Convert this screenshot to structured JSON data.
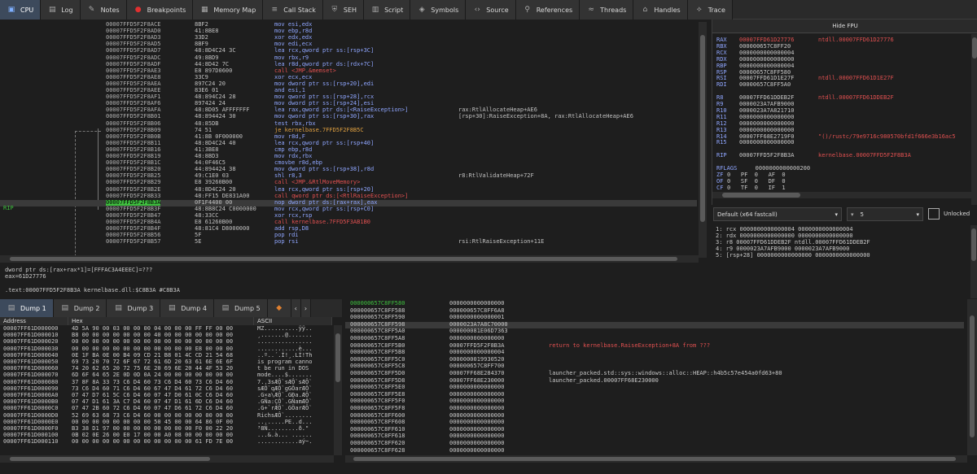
{
  "tabs": [
    {
      "label": "CPU",
      "icon": "cpu-icon",
      "active": true
    },
    {
      "label": "Log",
      "icon": "log-icon"
    },
    {
      "label": "Notes",
      "icon": "notes-icon"
    },
    {
      "label": "Breakpoints",
      "icon": "breakpoint-icon"
    },
    {
      "label": "Memory Map",
      "icon": "memory-map-icon"
    },
    {
      "label": "Call Stack",
      "icon": "call-stack-icon"
    },
    {
      "label": "SEH",
      "icon": "seh-icon"
    },
    {
      "label": "Script",
      "icon": "script-icon"
    },
    {
      "label": "Symbols",
      "icon": "symbols-icon"
    },
    {
      "label": "Source",
      "icon": "source-icon"
    },
    {
      "label": "References",
      "icon": "references-icon"
    },
    {
      "label": "Threads",
      "icon": "threads-icon"
    },
    {
      "label": "Handles",
      "icon": "handles-icon"
    },
    {
      "label": "Trace",
      "icon": "trace-icon"
    }
  ],
  "disasm": [
    {
      "addr": "00007FFD5F2F8ACE",
      "bytes": "8BF2",
      "ins": "mov esi,edx"
    },
    {
      "addr": "00007FFD5F2F8AD0",
      "bytes": "41:8BE8",
      "ins": "mov ebp,r8d"
    },
    {
      "addr": "00007FFD5F2F8AD3",
      "bytes": "33D2",
      "ins": "xor edx,edx"
    },
    {
      "addr": "00007FFD5F2F8AD5",
      "bytes": "8BF9",
      "ins": "mov edi,ecx"
    },
    {
      "addr": "00007FFD5F2F8AD7",
      "bytes": "48:8D4C24 3C",
      "ins": "lea rcx,qword ptr ss:[rsp+3C]"
    },
    {
      "addr": "00007FFD5F2F8ADC",
      "bytes": "49:8BD9",
      "ins": "mov rbx,r9"
    },
    {
      "addr": "00007FFD5F2F8ADF",
      "bytes": "44:8D42 7C",
      "ins": "lea r8d,qword ptr ds:[rdx+7C]"
    },
    {
      "addr": "00007FFD5F2F8AE3",
      "bytes": "E8 897D0600",
      "ins": "call <JMP.&memset>",
      "t": "call"
    },
    {
      "addr": "00007FFD5F2F8AE8",
      "bytes": "33C9",
      "ins": "xor ecx,ecx"
    },
    {
      "addr": "00007FFD5F2F8AEA",
      "bytes": "897C24 20",
      "ins": "mov dword ptr ss:[rsp+20],edi"
    },
    {
      "addr": "00007FFD5F2F8AEE",
      "bytes": "83E6 01",
      "ins": "and esi,1"
    },
    {
      "addr": "00007FFD5F2F8AF1",
      "bytes": "48:894C24 28",
      "ins": "mov qword ptr ss:[rsp+28],rcx"
    },
    {
      "addr": "00007FFD5F2F8AF6",
      "bytes": "897424 24",
      "ins": "mov dword ptr ss:[rsp+24],esi"
    },
    {
      "addr": "00007FFD5F2F8AFA",
      "bytes": "48:8D05 AFFFFFFF",
      "ins": "lea rax,qword ptr ds:[<RaiseException>]",
      "cmt": "rax:RtlAllocateHeap+AE6"
    },
    {
      "addr": "00007FFD5F2F8B01",
      "bytes": "48:894424 30",
      "ins": "mov qword ptr ss:[rsp+30],rax",
      "cmt": "[rsp+30]:RaiseException+8A, rax:RtlAllocateHeap+AE6"
    },
    {
      "addr": "00007FFD5F2F8B06",
      "bytes": "48:85DB",
      "ins": "test rbx,rbx"
    },
    {
      "addr": "00007FFD5F2F8B09",
      "bytes": "74 51",
      "ins": "je kernelbase.7FFD5F2F8B5C",
      "t": "jmp"
    },
    {
      "addr": "00007FFD5F2F8B0B",
      "bytes": "41:8B 0F000000",
      "ins": "mov r8d,F"
    },
    {
      "addr": "00007FFD5F2F8B11",
      "bytes": "48:8D4C24 40",
      "ins": "lea rcx,qword ptr ss:[rsp+40]"
    },
    {
      "addr": "00007FFD5F2F8B16",
      "bytes": "41:3BE8",
      "ins": "cmp ebp,r8d"
    },
    {
      "addr": "00007FFD5F2F8B19",
      "bytes": "48:8BD3",
      "ins": "mov rdx,rbx"
    },
    {
      "addr": "00007FFD5F2F8B1C",
      "bytes": "44:0F46C5",
      "ins": "cmovbe r8d,ebp"
    },
    {
      "addr": "00007FFD5F2F8B20",
      "bytes": "44:894424 38",
      "ins": "mov dword ptr ss:[rsp+38],r8d"
    },
    {
      "addr": "00007FFD5F2F8B25",
      "bytes": "49:C1E0 03",
      "ins": "shl r8,3",
      "cmt": "r8:RtlValidateHeap+72F"
    },
    {
      "addr": "00007FFD5F2F8B29",
      "bytes": "E8 39260B00",
      "ins": "call <JMP.&RtlMoveMemory>",
      "t": "call"
    },
    {
      "addr": "00007FFD5F2F8B2E",
      "bytes": "48:8D4C24 20",
      "ins": "lea rcx,qword ptr ss:[rsp+20]"
    },
    {
      "addr": "00007FFD5F2F8B33",
      "bytes": "48:FF15 DE831A00",
      "ins": "call qword ptr ds:[<RtlRaiseException>]",
      "t": "call"
    },
    {
      "addr": "00007FFD5F2F8B3A",
      "bytes": "0F1F4400 00",
      "ins": "nop dword ptr ds:[rax+rax],eax",
      "rip": true
    },
    {
      "addr": "00007FFD5F2F8B3F",
      "bytes": "48:8B8C24 C0000000",
      "ins": "mov rcx,qword ptr ss:[rsp+C0]"
    },
    {
      "addr": "00007FFD5F2F8B47",
      "bytes": "48:33CC",
      "ins": "xor rcx,rsp"
    },
    {
      "addr": "00007FFD5F2F8B4A",
      "bytes": "E8 61260B00",
      "ins": "call kernelbase.7FFD5F3AB1B0",
      "t": "call"
    },
    {
      "addr": "00007FFD5F2F8B4F",
      "bytes": "48:81C4 D8000000",
      "ins": "add rsp,D8"
    },
    {
      "addr": "00007FFD5F2F8B56",
      "bytes": "5F",
      "ins": "pop rdi"
    },
    {
      "addr": "00007FFD5F2F8B57",
      "bytes": "5E",
      "ins": "pop rsi",
      "cmt": "rsi:RtlRaiseException+11E"
    }
  ],
  "rip_label": "RIP",
  "info": {
    "line1": "dword ptr ds:[rax+rax*1]=[FFFAC3A4EEEC]=???",
    "line2": "eax=61D27776",
    "line3": ".text:00007FFD5F2F8B3A kernelbase.dll:$C8B3A #C8B3A"
  },
  "fpu_button": "Hide FPU",
  "registers": [
    {
      "n": "RAX",
      "v": "00007FFD61D27776",
      "c": "ntdll.00007FFD61D27776",
      "ch": true
    },
    {
      "n": "RBX",
      "v": "000000657C8FF20"
    },
    {
      "n": "RCX",
      "v": "0000000000000004"
    },
    {
      "n": "RDX",
      "v": "0000000000000000"
    },
    {
      "n": "RBP",
      "v": "0000000000000004"
    },
    {
      "n": "RSP",
      "v": "00000657C8FF580"
    },
    {
      "n": "RSI",
      "v": "00007FFD61D1E27F",
      "c": "ntdll.00007FFD61D1E27F"
    },
    {
      "n": "RDI",
      "v": "00000657C8FF5A0"
    },
    {
      "n": "",
      "v": ""
    },
    {
      "n": "R8",
      "v": "00007FFD61DDEB2F",
      "c": "ntdll.00007FFD61DDEB2F"
    },
    {
      "n": "R9",
      "v": "0000023A7AFB9000"
    },
    {
      "n": "R10",
      "v": "0000023A7A821710"
    },
    {
      "n": "R11",
      "v": "0000000000000000"
    },
    {
      "n": "R12",
      "v": "0000000000000000"
    },
    {
      "n": "R13",
      "v": "0000000000000000"
    },
    {
      "n": "R14",
      "v": "00007FF68E2719F0",
      "c": "\"()/rustc/79e9716c980570bfd1f666e3b16ac5"
    },
    {
      "n": "R15",
      "v": "0000000000000000"
    },
    {
      "n": "",
      "v": ""
    },
    {
      "n": "RIP",
      "v": "00007FFD5F2F8B3A",
      "c": "kernelbase.00007FFD5F2F8B3A"
    },
    {
      "n": "",
      "v": ""
    },
    {
      "n": "RFLAGS",
      "v": "   0000000000000200"
    },
    {
      "n": "ZF",
      "v": "0   PF  0   AF  0"
    },
    {
      "n": "OF",
      "v": "0   SF  0   DF  0"
    },
    {
      "n": "CF",
      "v": "0   TF  0   IF  1"
    }
  ],
  "callconv": {
    "value": "Default (x64 fastcall)",
    "count": "5",
    "unlocked_label": "Unlocked"
  },
  "args": [
    "1: rcx 0000000000000004 0000000000000004",
    "2: rdx 0000000000000000 0000000000000000",
    "3: r8 00007FFD61DDEB2F ntdll.00007FFD61DDEB2F",
    "4: r9 0000023A7AFB9000 0000023A7AFB9000",
    "5: [rsp+28] 0000000000000000 0000000000000000"
  ],
  "dump_tabs": [
    "Dump 1",
    "Dump 2",
    "Dump 3",
    "Dump 4",
    "Dump 5"
  ],
  "dump_headers": {
    "address": "Address",
    "hex": "Hex",
    "ascii": "ASCII"
  },
  "dump_rows": [
    {
      "a": "00007FF61D000000",
      "h": "4D 5A 90 00 03 00 00 00 04 00 00 00 FF FF 00 00",
      "t": "MZ..........ÿÿ.."
    },
    {
      "a": "00007FF61D000010",
      "h": "B8 00 00 00 00 00 00 00 40 00 00 00 00 00 00 00",
      "t": "¸.......@......."
    },
    {
      "a": "00007FF61D000020",
      "h": "00 00 00 00 00 00 00 00 00 00 00 00 00 00 00 00",
      "t": "................"
    },
    {
      "a": "00007FF61D000030",
      "h": "00 00 00 00 00 00 00 00 00 00 00 00 E8 00 00 00",
      "t": "............è..."
    },
    {
      "a": "00007FF61D000040",
      "h": "0E 1F BA 0E 00 B4 09 CD 21 B8 01 4C CD 21 54 68",
      "t": "..º..´.Í!¸.LÍ!Th"
    },
    {
      "a": "00007FF61D000050",
      "h": "69 73 20 70 72 6F 67 72 61 6D 20 63 61 6E 6E 6F",
      "t": "is program canno"
    },
    {
      "a": "00007FF61D000060",
      "h": "74 20 62 65 20 72 75 6E 20 69 6E 20 44 4F 53 20",
      "t": "t be run in DOS "
    },
    {
      "a": "00007FF61D000070",
      "h": "6D 6F 64 65 2E 0D 0D 0A 24 00 00 00 00 00 00 00",
      "t": "mode....$......."
    },
    {
      "a": "00007FF61D000080",
      "h": "37 8F 8A 33 73 C6 D4 60 73 C6 D4 60 73 C6 D4 60",
      "t": "7..3sÆÔ`sÆÔ`sÆÔ`"
    },
    {
      "a": "00007FF61D000090",
      "h": "73 C6 D4 60 71 C6 D4 60 67 47 D4 61 72 C6 D4 60",
      "t": "sÆÔ`qÆÔ`gGÔarÆÔ`"
    },
    {
      "a": "00007FF61D0000A0",
      "h": "07 47 D7 61 5C C6 D4 60 07 47 D0 61 0C C6 D4 60",
      "t": ".G×a\\ÆÔ`.GÐa.ÆÔ`"
    },
    {
      "a": "00007FF61D0000B0",
      "h": "07 47 D1 61 3A C7 D4 60 07 47 D1 61 6D C6 D4 60",
      "t": ".GÑa:ÇÔ`.GÑamÆÔ`"
    },
    {
      "a": "00007FF61D0000C0",
      "h": "07 47 2B 60 72 C6 D4 60 07 47 D6 61 72 C6 D4 60",
      "t": ".G+`rÆÔ`.GÖarÆÔ`"
    },
    {
      "a": "00007FF61D0000D0",
      "h": "52 69 63 68 73 C6 D4 60 00 00 00 00 00 00 00 00",
      "t": "RichsÆÔ`........"
    },
    {
      "a": "00007FF61D0000E0",
      "h": "00 00 00 00 00 00 00 00 50 45 00 00 64 86 0F 00",
      "t": "........PE..d..."
    },
    {
      "a": "00007FF61D0000F0",
      "h": "B3 38 D1 97 00 00 00 00 00 00 00 00 F0 00 22 20",
      "t": "³8Ñ.........ð.\" "
    },
    {
      "a": "00007FF61D000100",
      "h": "0B 02 0E 26 00 E0 17 00 00 A0 08 00 00 00 00 00",
      "t": "...&.à... ......"
    },
    {
      "a": "00007FF61D000110",
      "h": "00 00 00 00 00 00 00 00 00 00 00 00 61 FD 7E 00",
      "t": "............aý~."
    }
  ],
  "stack_rows": [
    {
      "a": "000000657C8FF580",
      "v": "0000000000000000",
      "ac": true
    },
    {
      "a": "000000657C8FF588",
      "v": "000000657C8FF6A8"
    },
    {
      "a": "000000657C8FF590",
      "v": "0000000000000001"
    },
    {
      "a": "000000657C8FF598",
      "v": "0000023A7A8C70000",
      "hl": true
    },
    {
      "a": "000000657C8FF5A0",
      "v": "000000081E06D7363"
    },
    {
      "a": "000000657C8FF5A8",
      "v": "0000000000000000"
    },
    {
      "a": "000000657C8FF5B0",
      "v": "00007FFD5F2F8B3A",
      "c": "return to kernelbase.RaiseException+8A from ???",
      "red": true
    },
    {
      "a": "000000657C8FF5B8",
      "v": "0000000000000004"
    },
    {
      "a": "000000657C8FF5C0",
      "v": "0000000019930520"
    },
    {
      "a": "000000657C8FF5C8",
      "v": "000000657C8FF700"
    },
    {
      "a": "000000657C8FF5D0",
      "v": "00007FF68E284370",
      "c": "launcher_packed.std::sys::windows::alloc::HEAP::h4b5c57e454a0fd63+80"
    },
    {
      "a": "000000657C8FF5D8",
      "v": "00007FF68E230000",
      "c": "launcher_packed.00007FF68E230000"
    },
    {
      "a": "000000657C8FF5E0",
      "v": "0000000000000000"
    },
    {
      "a": "000000657C8FF5E8",
      "v": "0000000000000000"
    },
    {
      "a": "000000657C8FF5F0",
      "v": "0000000000000000"
    },
    {
      "a": "000000657C8FF5F8",
      "v": "0000000000000000"
    },
    {
      "a": "000000657C8FF600",
      "v": "0000000000000000"
    },
    {
      "a": "000000657C8FF608",
      "v": "0000000000000000"
    },
    {
      "a": "000000657C8FF610",
      "v": "0000000000000000"
    },
    {
      "a": "000000657C8FF618",
      "v": "0000000000000000"
    },
    {
      "a": "000000657C8FF620",
      "v": "0000000000000000"
    },
    {
      "a": "000000657C8FF628",
      "v": "0000000000000000"
    }
  ]
}
